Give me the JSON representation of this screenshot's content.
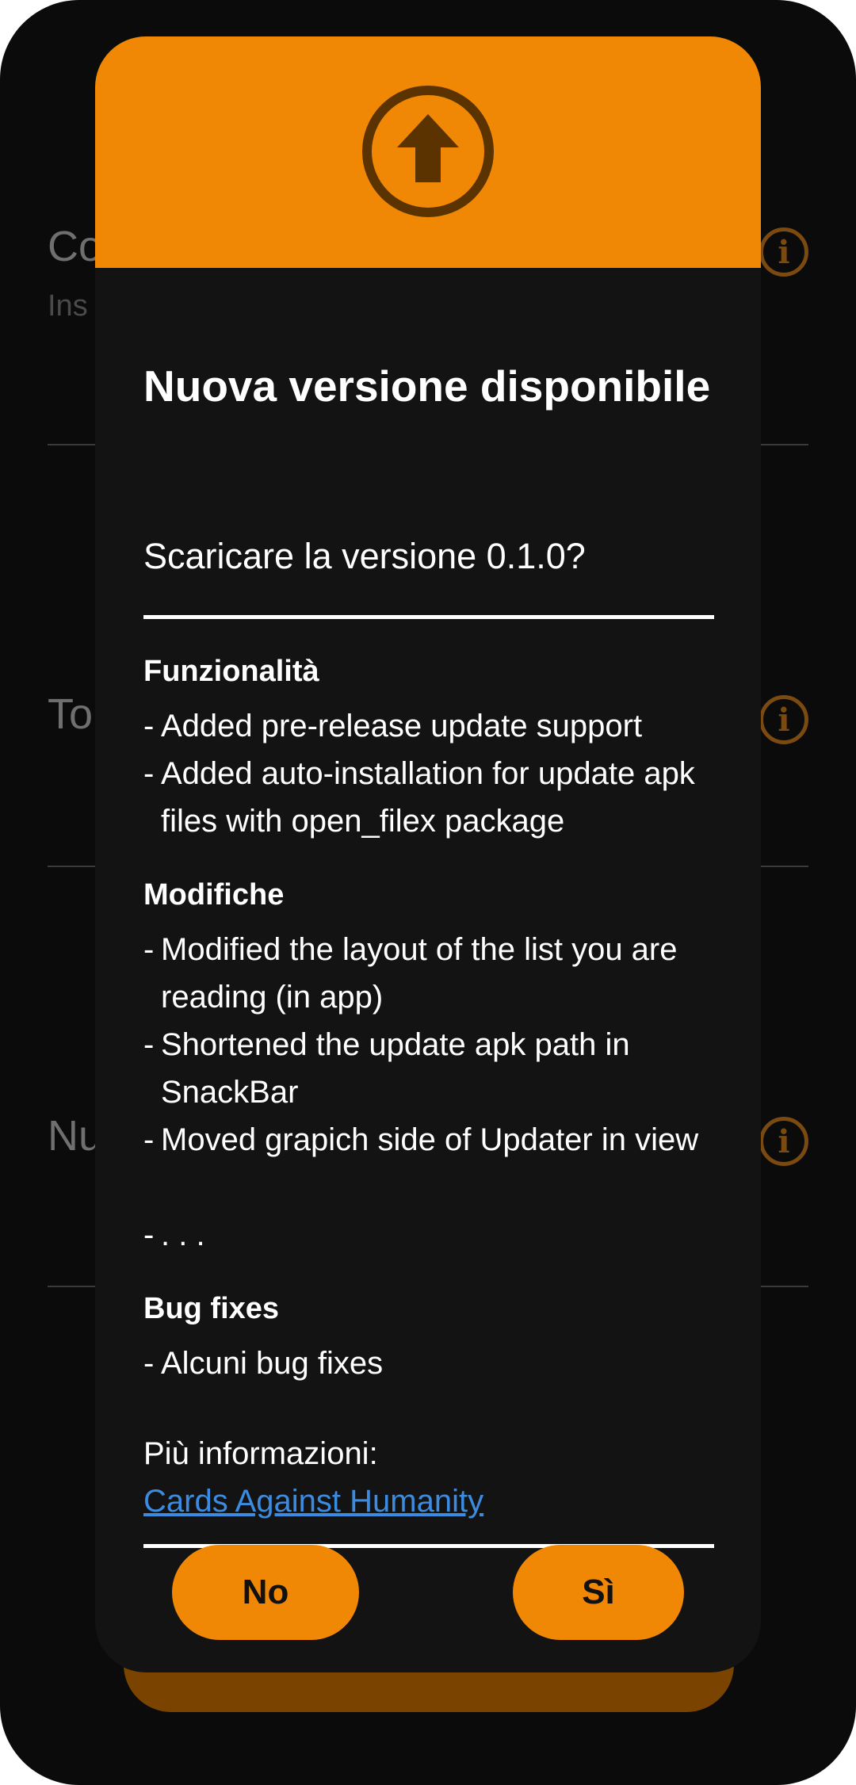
{
  "background": {
    "items": [
      {
        "title": "Co",
        "subtitle": "Ins"
      },
      {
        "title": "To",
        "subtitle": ""
      },
      {
        "title": "Nu",
        "subtitle": ""
      }
    ],
    "info_icon_glyph": "i",
    "accent_dim": "#7a4a10"
  },
  "dialog": {
    "header_color": "#f08705",
    "icon": "upload-arrow-icon",
    "title": "Nuova versione disponibile",
    "subtitle": "Scaricare la versione 0.1.0?",
    "sections": [
      {
        "title": "Funzionalità",
        "entries": [
          "Added pre-release update support",
          "Added auto-installation for update apk files with open_filex package"
        ]
      },
      {
        "title": "Modifiche",
        "entries": [
          "Modified the layout of the list you are reading (in app)",
          "Shortened the update apk path in SnackBar",
          "Moved grapich side of Updater in view",
          ". . ."
        ]
      },
      {
        "title": "Bug fixes",
        "entries": [
          "Alcuni bug fixes"
        ]
      }
    ],
    "more_info_label": "Più informazioni:",
    "more_info_link": "Cards Against Humanity",
    "buttons": {
      "no": "No",
      "yes": "Sì"
    }
  }
}
